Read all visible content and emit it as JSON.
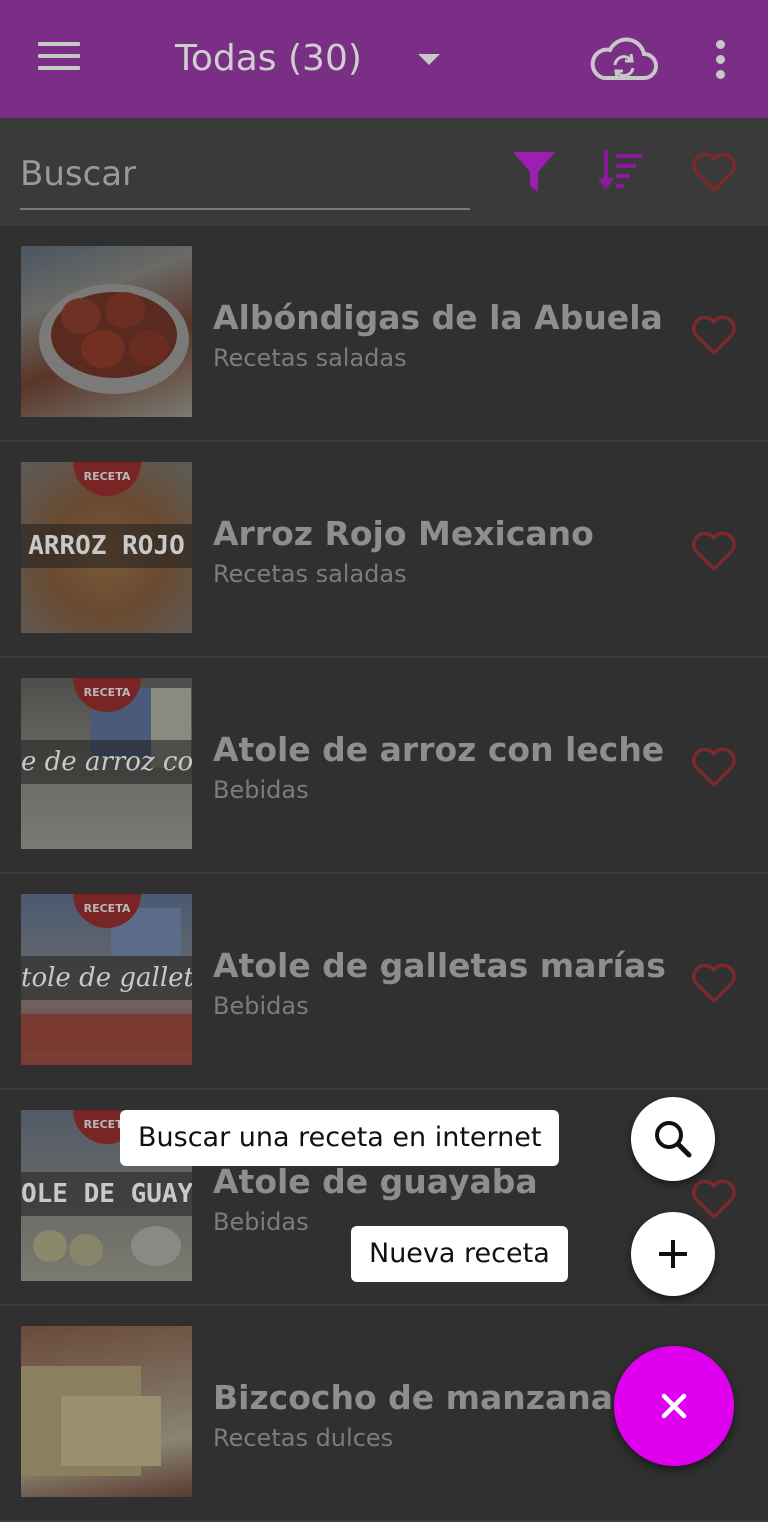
{
  "app_bar": {
    "title": "Todas (30)",
    "menu_icon": "hamburger-menu-icon",
    "dropdown_icon": "caret-down-icon",
    "sync_icon": "cloud-sync-icon",
    "more_icon": "more-vert-icon",
    "background": "#7a2e86"
  },
  "search": {
    "placeholder": "Buscar",
    "value": "",
    "filter_icon": "filter-icon",
    "sort_icon": "sort-icon",
    "favorites_icon": "heart-outline-icon",
    "accent": "#9b1fb0"
  },
  "recipes": [
    {
      "name": "Albóndigas de la Abuela",
      "category": "Recetas saladas",
      "badge": "",
      "thumb_text": "",
      "favorite": false
    },
    {
      "name": "Arroz Rojo Mexicano",
      "category": "Recetas saladas",
      "badge": "RECETA",
      "thumb_text": "ARROZ ROJO",
      "favorite": false
    },
    {
      "name": "Atole de arroz con leche",
      "category": "Bebidas",
      "badge": "RECETA",
      "thumb_text": "e de arroz con l",
      "favorite": false
    },
    {
      "name": "Atole de galletas marías",
      "category": "Bebidas",
      "badge": "RECETA",
      "thumb_text": "tole de galleta",
      "favorite": false
    },
    {
      "name": "Atole de guayaba",
      "category": "Bebidas",
      "badge": "RECETA",
      "thumb_text": "OLE DE GUAYA",
      "favorite": false
    },
    {
      "name": "Bizcocho de manzana",
      "category": "Recetas dulces",
      "badge": "",
      "thumb_text": "",
      "favorite": false
    }
  ],
  "fab_menu": {
    "search_online_label": "Buscar una receta en internet",
    "search_online_icon": "search-icon",
    "new_recipe_label": "Nueva receta",
    "new_recipe_icon": "plus-icon",
    "close_icon": "close-icon",
    "fab_color": "#e000f0"
  },
  "colors": {
    "heart": "#7a2a2a",
    "background": "#303030"
  }
}
